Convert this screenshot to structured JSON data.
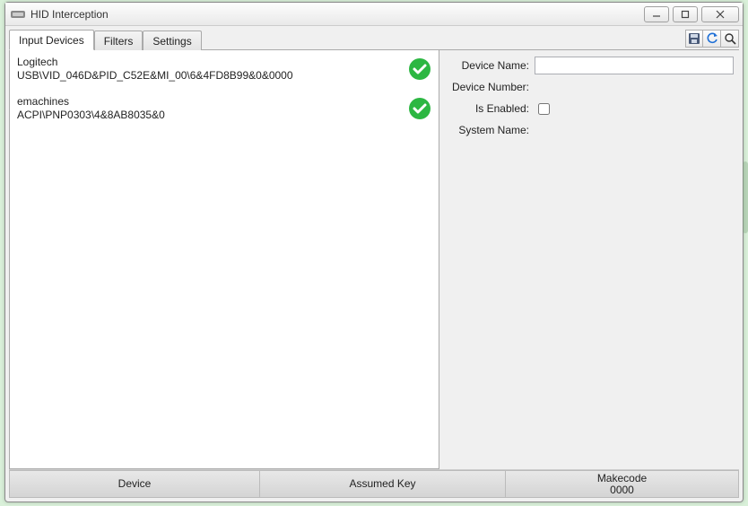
{
  "window": {
    "title": "HID Interception"
  },
  "tabs": {
    "input_devices": "Input Devices",
    "filters": "Filters",
    "settings": "Settings"
  },
  "toolbar": {
    "save": "save",
    "refresh": "refresh",
    "search": "search"
  },
  "devices": [
    {
      "name": "Logitech",
      "path": "USB\\VID_046D&PID_C52E&MI_00\\6&4FD8B99&0&0000",
      "enabled": true
    },
    {
      "name": "emachines",
      "path": "ACPI\\PNP0303\\4&8AB8035&0",
      "enabled": true
    }
  ],
  "details": {
    "labels": {
      "device_name": "Device Name:",
      "device_number": "Device Number:",
      "is_enabled": "Is Enabled:",
      "system_name": "System Name:"
    },
    "values": {
      "device_name": "",
      "device_number": "",
      "is_enabled": false,
      "system_name": ""
    }
  },
  "status": {
    "device": {
      "header": "Device",
      "value": ""
    },
    "assumed_key": {
      "header": "Assumed Key",
      "value": ""
    },
    "makecode": {
      "header": "Makecode",
      "value": "0000"
    }
  }
}
